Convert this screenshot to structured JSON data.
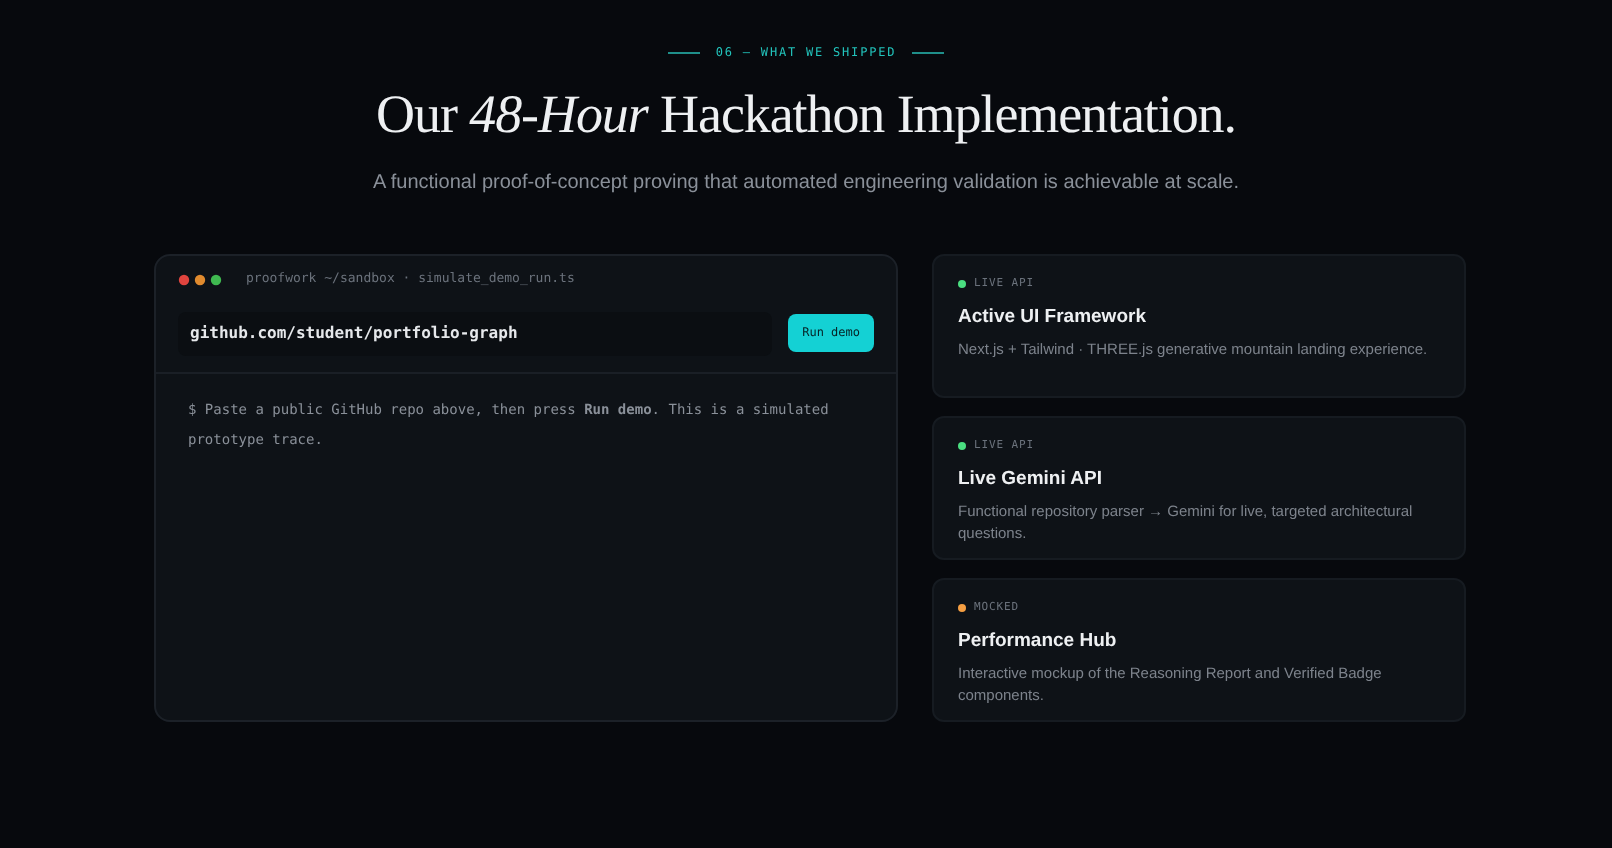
{
  "eyebrow": "06 — WHAT WE SHIPPED",
  "title": "Our *48-Hour* Hackathon Implementation.",
  "subtitle": "A functional proof-of-concept proving that automated engineering validation is achievable at scale.",
  "terminal": {
    "path": "proofwork ~/sandbox · simulate_demo_run.ts",
    "repo_input": {
      "value": "github.com/student/portfolio-graph"
    },
    "run_button": "Run demo",
    "output": "$ Paste a public GitHub repo above, then press **Run demo**. This is a simulated prototype trace."
  },
  "features": [
    {
      "status": "LIVE API",
      "color": "#4ade80",
      "title": "Active UI Framework",
      "description": "Next.js + Tailwind · THREE.js generative mountain landing experience."
    },
    {
      "status": "LIVE API",
      "color": "#4ade80",
      "title": "Live Gemini API",
      "description": "Functional repository parser → Gemini for live, targeted architectural questions."
    },
    {
      "status": "MOCKED",
      "color": "#f59e42",
      "title": "Performance Hub",
      "description": "Interactive mockup of the Reasoning Report and Verified Badge components."
    }
  ]
}
